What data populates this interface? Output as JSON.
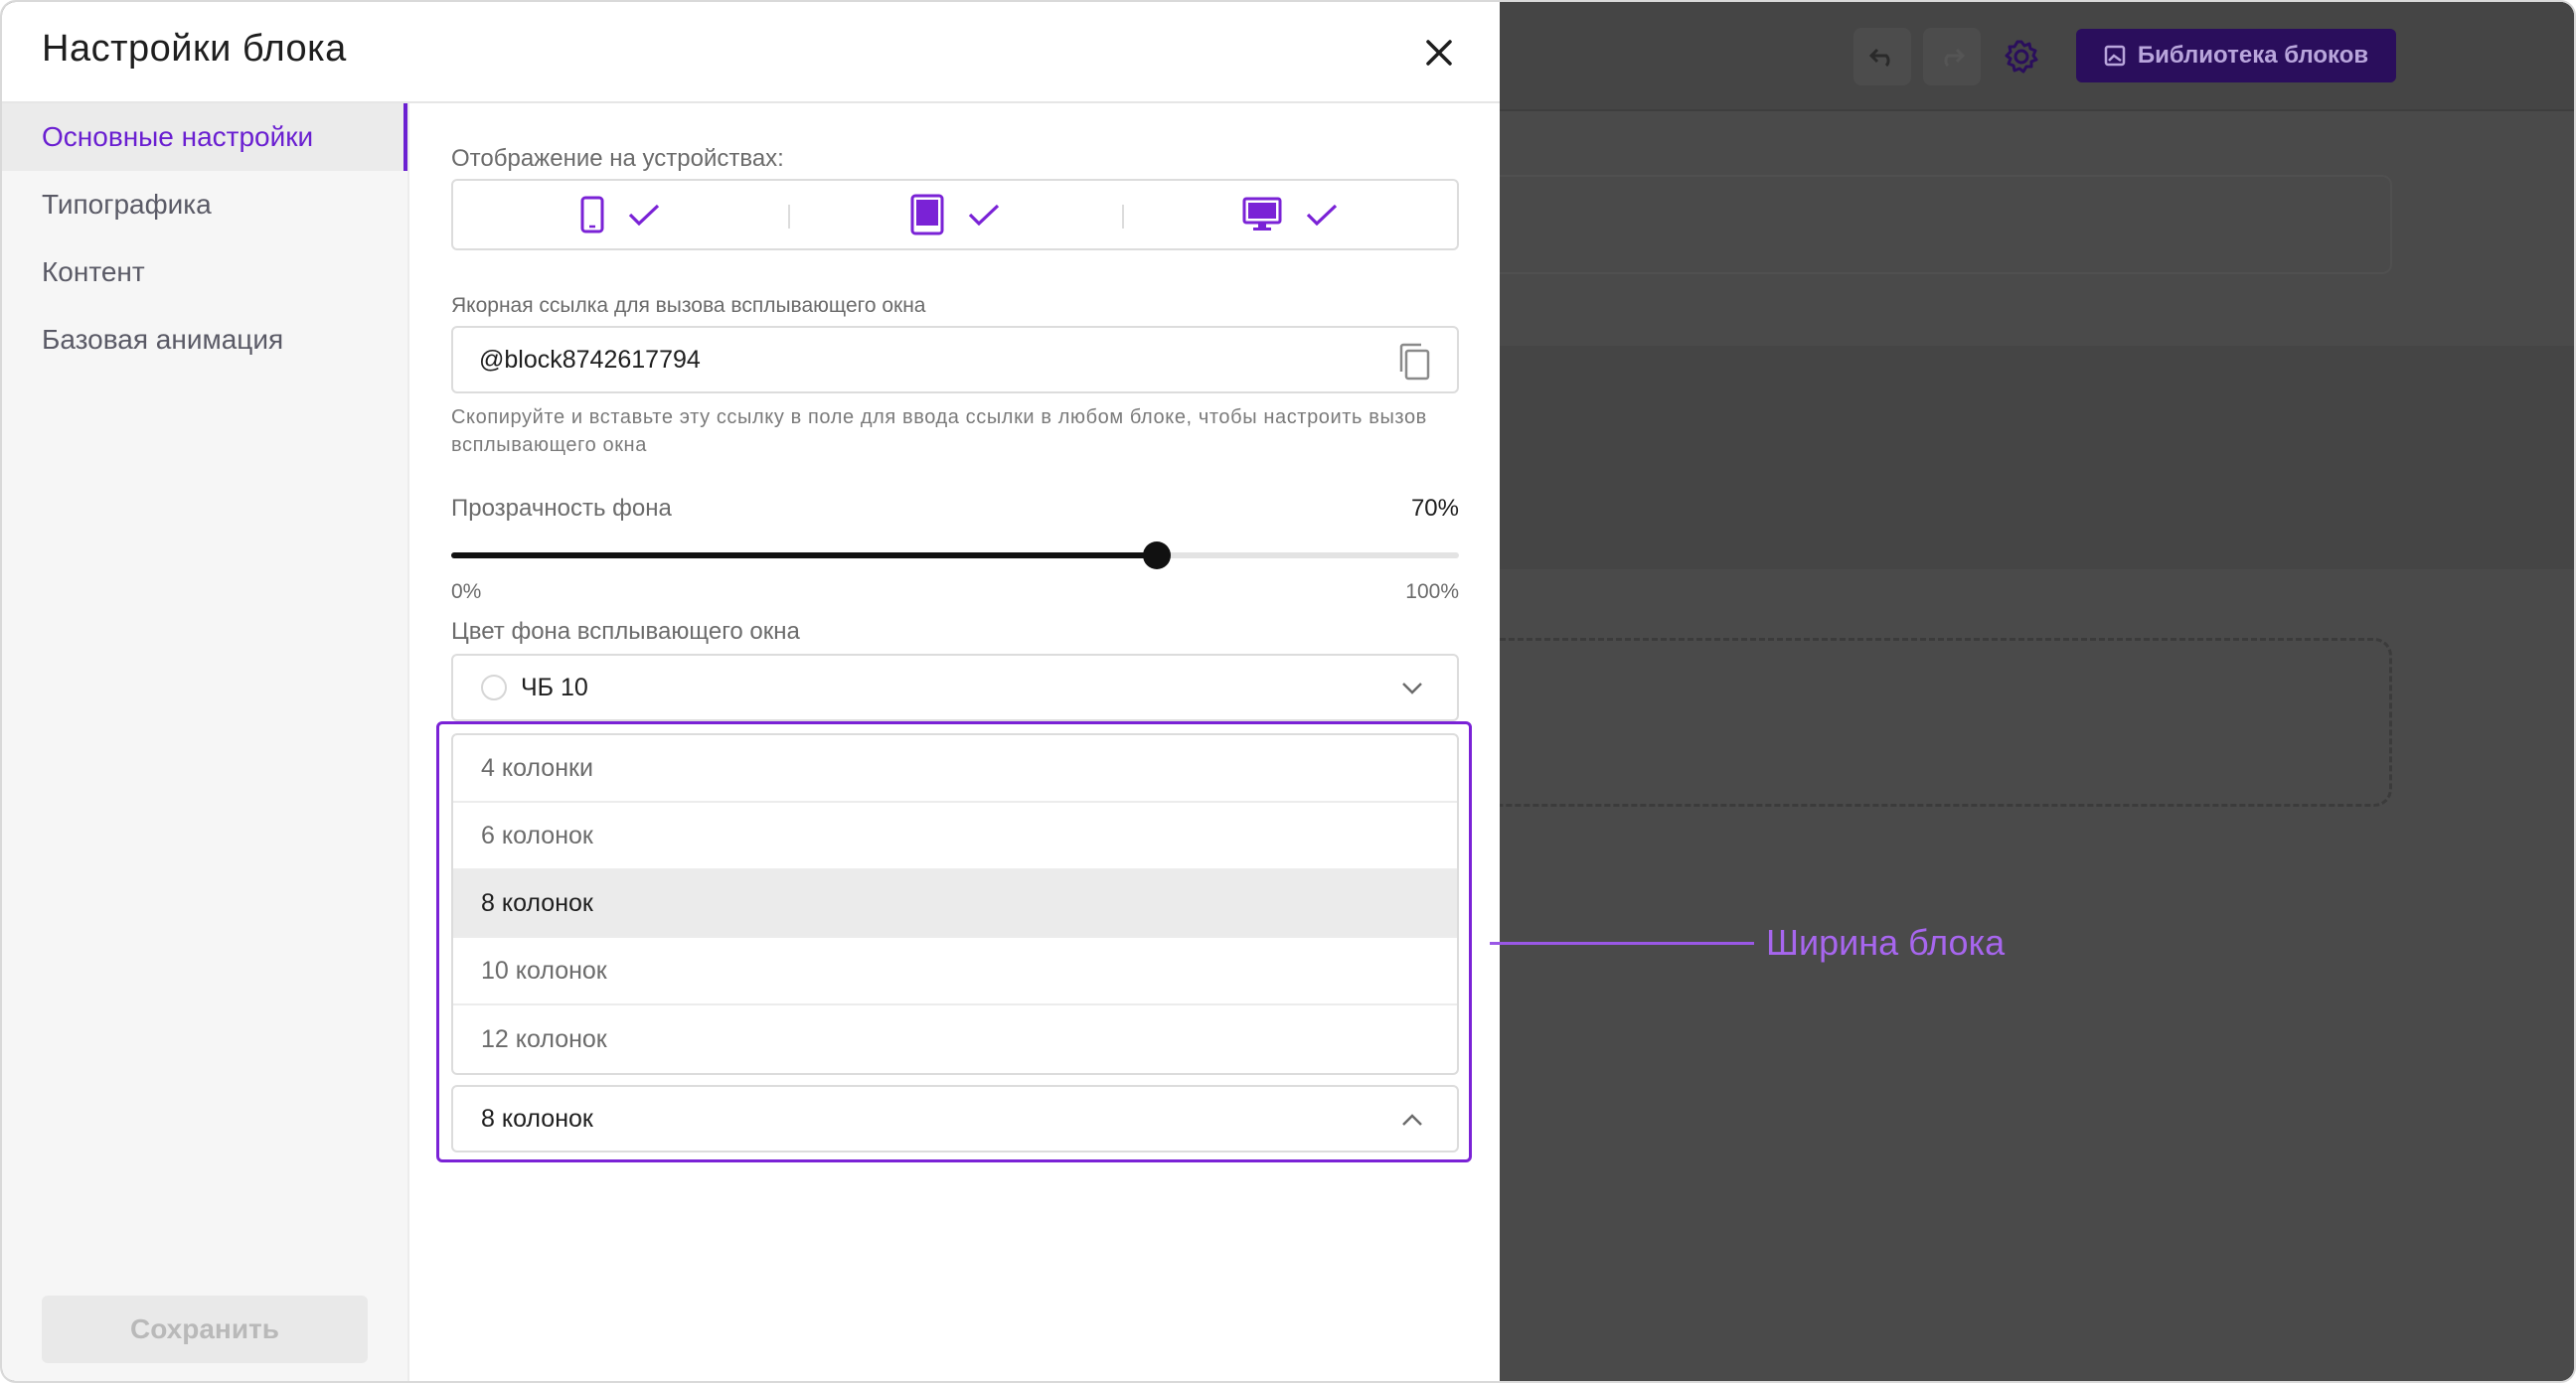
{
  "modal": {
    "title": "Настройки блока",
    "close_icon": "close-icon"
  },
  "sidebar": {
    "items": [
      {
        "label": "Основные настройки",
        "active": true
      },
      {
        "label": "Типографика",
        "active": false
      },
      {
        "label": "Контент",
        "active": false
      },
      {
        "label": "Базовая анимация",
        "active": false
      }
    ],
    "save_label": "Сохранить"
  },
  "devices": {
    "label": "Отображение на устройствах:",
    "items": [
      {
        "icon": "smartphone-icon",
        "checked": true
      },
      {
        "icon": "tablet-icon",
        "checked": true
      },
      {
        "icon": "desktop-icon",
        "checked": true
      }
    ]
  },
  "anchor": {
    "label": "Якорная ссылка для вызова всплывающего окна",
    "value": "@block8742617794",
    "copy_icon": "copy-icon",
    "hint": "Скопируйте и вставьте эту ссылку в поле для ввода ссылки в любом блоке, чтобы настроить вызов всплывающего окна"
  },
  "opacity": {
    "label": "Прозрачность фона",
    "value_text": "70%",
    "value": 0.7,
    "min_label": "0%",
    "max_label": "100%"
  },
  "bg_color": {
    "label": "Цвет фона всплывающего окна",
    "value": "ЧБ 10",
    "swatch_color": "#ffffff"
  },
  "width": {
    "options": [
      "4 колонки",
      "6 колонок",
      "8 колонок",
      "10 колонок",
      "12 колонок"
    ],
    "selected_index": 2,
    "value": "8 колонок"
  },
  "callout": {
    "text": "Ширина блока"
  },
  "editor": {
    "library_label": "Библиотека блоков"
  },
  "colors": {
    "accent": "#6a1fd1",
    "callout": "#a766ee",
    "overlay": "#4a4a4a"
  }
}
